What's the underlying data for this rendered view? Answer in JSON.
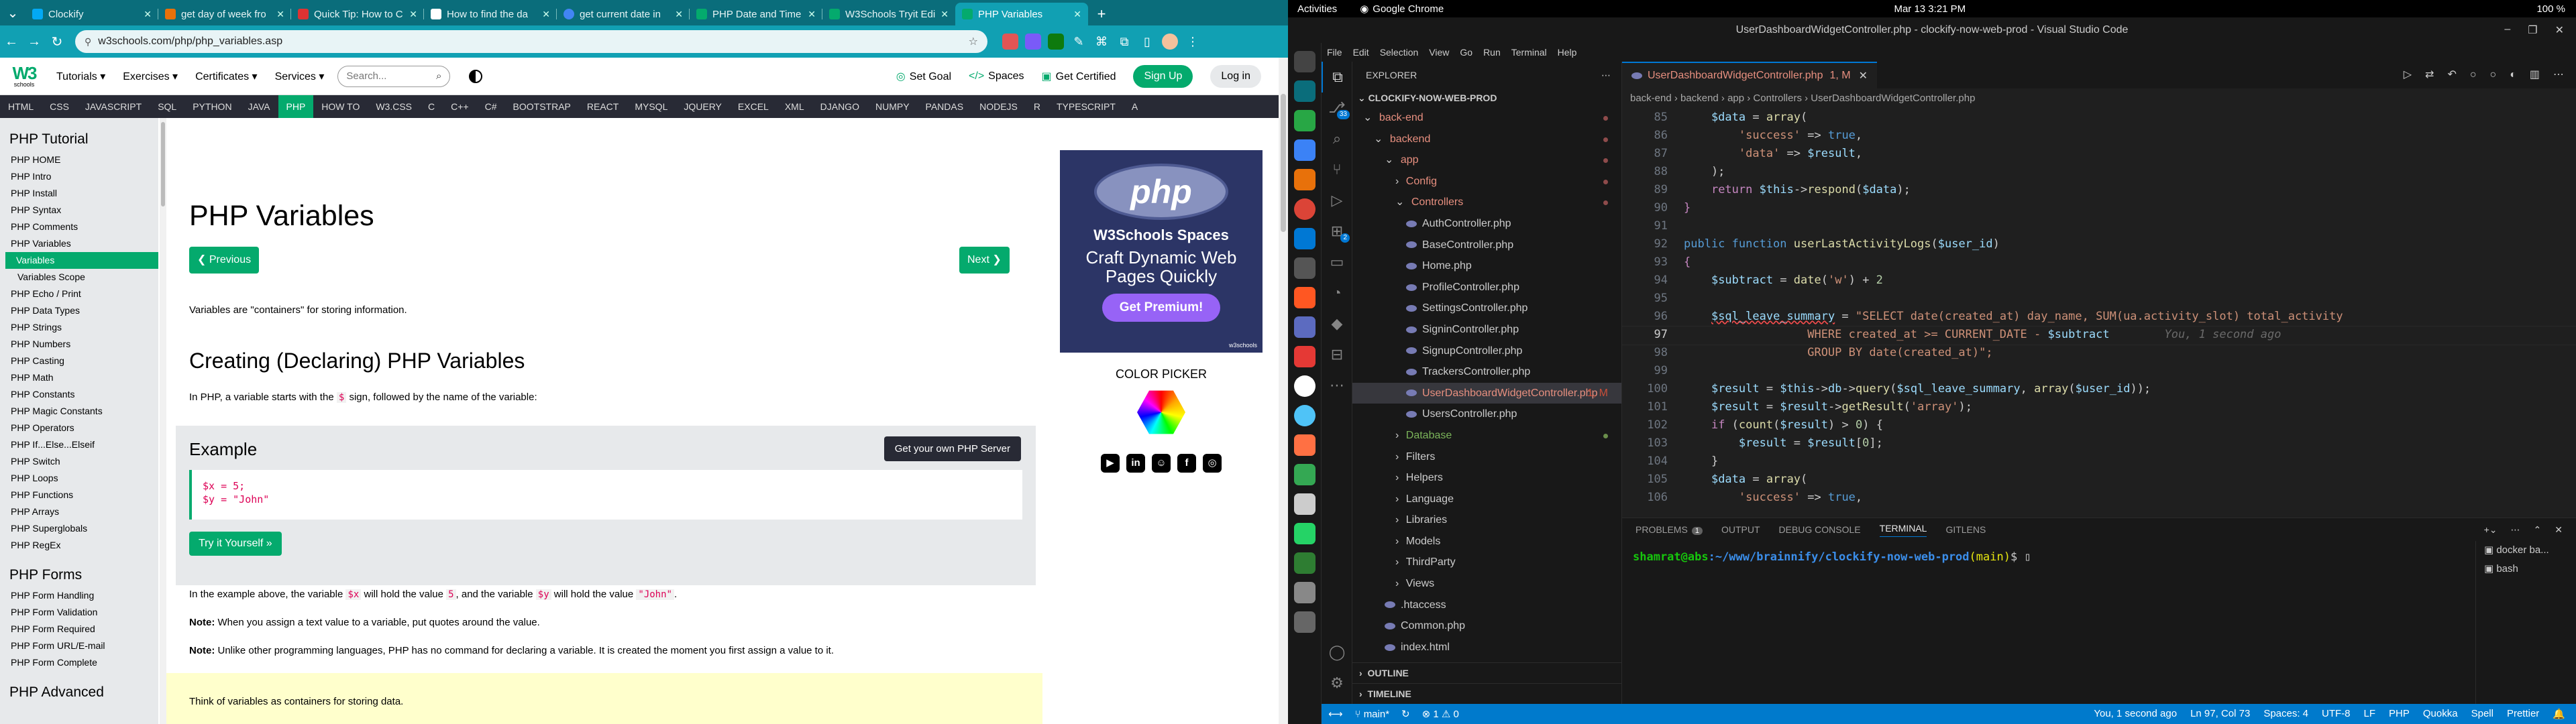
{
  "browser": {
    "tabs": [
      "Clockify",
      "get day of week fro",
      "Quick Tip: How to C",
      "How to find the da",
      "get current date in",
      "PHP Date and Time",
      "W3Schools Tryit Edi",
      "PHP Variables"
    ],
    "active_tab": 7,
    "url": "w3schools.com/php/php_variables.asp"
  },
  "w3": {
    "logo_main": "W3",
    "logo_sub": "schools",
    "menu": [
      "Tutorials ▾",
      "Exercises ▾",
      "Certificates ▾",
      "Services ▾"
    ],
    "search_placeholder": "Search...",
    "right": {
      "goal": "Set Goal",
      "spaces": "Spaces",
      "certified": "Get Certified",
      "signup": "Sign Up",
      "login": "Log in"
    },
    "nav": [
      "HTML",
      "CSS",
      "JAVASCRIPT",
      "SQL",
      "PYTHON",
      "JAVA",
      "PHP",
      "HOW TO",
      "W3.CSS",
      "C",
      "C++",
      "C#",
      "BOOTSTRAP",
      "REACT",
      "MYSQL",
      "JQUERY",
      "EXCEL",
      "XML",
      "DJANGO",
      "NUMPY",
      "PANDAS",
      "NODEJS",
      "R",
      "TYPESCRIPT",
      "A"
    ],
    "nav_active": 6
  },
  "sidebar": {
    "title": "PHP Tutorial",
    "items": [
      "PHP HOME",
      "PHP Intro",
      "PHP Install",
      "PHP Syntax",
      "PHP Comments",
      "PHP Variables",
      "Variables",
      "Variables Scope",
      "PHP Echo / Print",
      "PHP Data Types",
      "PHP Strings",
      "PHP Numbers",
      "PHP Casting",
      "PHP Math",
      "PHP Constants",
      "PHP Magic Constants",
      "PHP Operators",
      "PHP If...Else...Elseif",
      "PHP Switch",
      "PHP Loops",
      "PHP Functions",
      "PHP Arrays",
      "PHP Superglobals",
      "PHP RegEx"
    ],
    "title2": "PHP Forms",
    "items2": [
      "PHP Form Handling",
      "PHP Form Validation",
      "PHP Form Required",
      "PHP Form URL/E-mail",
      "PHP Form Complete"
    ],
    "title3": "PHP Advanced"
  },
  "content": {
    "h1": "PHP Variables",
    "prev": "❮ Previous",
    "next": "Next ❯",
    "intro": "Variables are \"containers\" for storing information.",
    "h2": "Creating (Declaring) PHP Variables",
    "p1a": "In PHP, a variable starts with the ",
    "p1b": "$",
    "p1c": " sign, followed by the name of the variable:",
    "example": "Example",
    "server_btn": "Get your own PHP Server",
    "code1": "$x = 5;",
    "code2": "$y = \"John\"",
    "tryit": "Try it Yourself »",
    "p2a": "In the example above, the variable ",
    "p2b": "$x",
    "p2c": " will hold the value ",
    "p2d": "5",
    "p2e": ", and the variable ",
    "p2f": "$y",
    "p2g": " will hold the value ",
    "p2h": "\"John\"",
    "p2i": ".",
    "note1_b": "Note:",
    "note1": " When you assign a text value to a variable, put quotes around the value.",
    "note2_b": "Note:",
    "note2": " Unlike other programming languages, PHP has no command for declaring a variable. It is created the moment you first assign a value to it.",
    "think": "Think of variables as containers for storing data.",
    "ad": {
      "logo": "php",
      "t1": "W3Schools Spaces",
      "t2": "Craft Dynamic Web Pages Quickly",
      "btn": "Get Premium!",
      "wlogo": "w3schools"
    },
    "color_picker": "COLOR PICKER"
  },
  "system": {
    "activities": "Activities",
    "app": "Google Chrome",
    "clock": "Mar 13  3:21 PM",
    "battery": "100 %"
  },
  "vscode": {
    "title": "UserDashboardWidgetController.php - clockify-now-web-prod - Visual Studio Code",
    "menu": [
      "File",
      "Edit",
      "Selection",
      "View",
      "Go",
      "Run",
      "Terminal",
      "Help"
    ],
    "explorer": "EXPLORER",
    "project": "CLOCKIFY-NOW-WEB-PROD",
    "tree": [
      "back-end",
      "backend",
      "app",
      "Config",
      "Controllers",
      "AuthController.php",
      "BaseController.php",
      "Home.php",
      "ProfileController.php",
      "SettingsController.php",
      "SigninController.php",
      "SignupController.php",
      "TrackersController.php",
      "UserDashboardWidgetController.php",
      "UsersController.php",
      "Database",
      "Filters",
      "Helpers",
      "Language",
      "Libraries",
      "Models",
      "ThirdParty",
      "Views",
      ".htaccess",
      "Common.php",
      "index.html"
    ],
    "modified_marker": "1, M",
    "outline": "OUTLINE",
    "timeline": "TIMELINE",
    "tab": "UserDashboardWidgetController.php",
    "tab_marker": "1, M",
    "breadcrumbs": "back-end › backend › app › Controllers › UserDashboardWidgetController.php",
    "line_numbers": [
      "85",
      "86",
      "87",
      "88",
      "89",
      "90",
      "91",
      "92",
      "93",
      "94",
      "95",
      "96",
      "97",
      "98",
      "99",
      "100",
      "101",
      "102",
      "103",
      "104",
      "105",
      "106"
    ],
    "blame": "You, 1 second ago",
    "panel_tabs": [
      "PROBLEMS",
      "OUTPUT",
      "DEBUG CONSOLE",
      "TERMINAL",
      "GITLENS"
    ],
    "problems_count": "1",
    "term_user": "shamrat@abs",
    "term_path": ":~/www/brainnify/clockify-now-web-prod",
    "term_branch": "(main)",
    "term_end": "$",
    "terminals": [
      "docker ba...",
      "bash"
    ],
    "status": {
      "branch": "main*",
      "errors": "⊗ 1 ⚠ 0",
      "blame": "You, 1 second ago",
      "pos": "Ln 97, Col 73",
      "spaces": "Spaces: 4",
      "enc": "UTF-8",
      "eol": "LF",
      "lang": "PHP",
      "q": "Quokka",
      "spell": "Spell",
      "prettier": "Prettier"
    }
  },
  "colors": {
    "w3green": "#04aa6d",
    "chrome": "#11a0b3",
    "vsblue": "#007acc"
  }
}
